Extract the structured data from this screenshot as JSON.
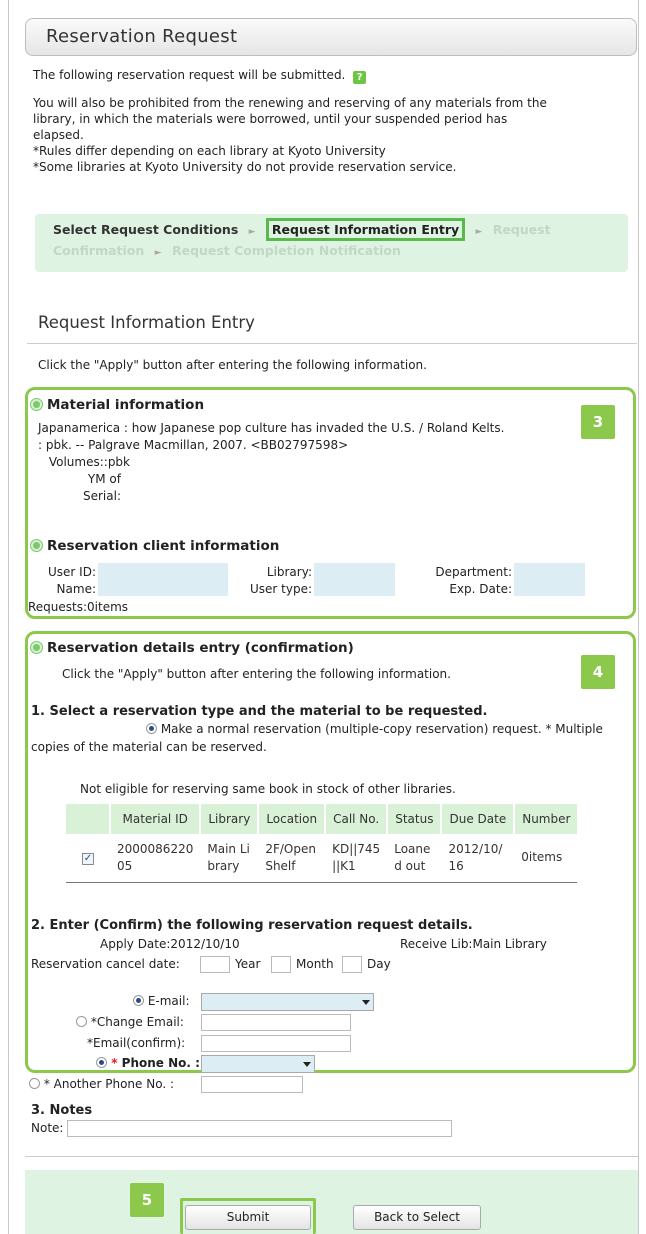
{
  "page": {
    "title": "Reservation Request",
    "intro": "The following reservation request will be submitted.",
    "help_icon": "?",
    "notice_lines": [
      "You will also be prohibited from the renewing and reserving of any materials from the",
      "library, in which the materials were borrowed, until your suspended period has",
      "elapsed.",
      "*Rules differ depending on each library at Kyoto University",
      "*Some libraries at Kyoto University do not provide reservation service."
    ]
  },
  "steps": {
    "step1": "Select Request Conditions",
    "step2": "Request Information Entry",
    "step3a": "Request",
    "step3b": "Confirmation",
    "step4": "Request Completion Notification",
    "arrow": "►"
  },
  "section": {
    "heading": "Request Information Entry",
    "instruction": "Click the \"Apply\" button after entering the following information."
  },
  "badges": {
    "b3": "3",
    "b4": "4",
    "b5": "5"
  },
  "material": {
    "heading": "Material information",
    "line1": "Japanamerica : how Japanese pop culture has invaded the U.S. / Roland Kelts.",
    "line2": ": pbk. -- Palgrave Macmillan, 2007.  <BB02797598>",
    "volumes_label": "Volumes::",
    "volumes_value": "pbk",
    "ym_label_1": "YM of",
    "ym_label_2": "Serial:"
  },
  "client": {
    "heading": "Reservation client information",
    "user_id_label": "User ID:",
    "name_label": "Name:",
    "library_label": "Library:",
    "user_type_label": "User type:",
    "department_label": "Department:",
    "exp_date_label": "Exp. Date:",
    "requests": "Requests:0items"
  },
  "details": {
    "heading": "Reservation details entry (confirmation)",
    "instruction": "Click the \"Apply\" button after entering the following information.",
    "step1_title": "1. Select a reservation type and the material to be requested.",
    "normal_option_a": "Make a normal reservation (multiple-copy reservation) request. * Multiple",
    "normal_option_b": "copies of the material can be reserved.",
    "not_eligible": "Not eligible for reserving same book in stock of other libraries.",
    "table_headers": [
      "Material ID",
      "Library",
      "Location",
      "Call No.",
      "Status",
      "Due Date",
      "Number"
    ],
    "table_row": {
      "material_id_a": "2000086220",
      "material_id_b": "05",
      "library_a": "Main Li",
      "library_b": "brary",
      "location_a": "2F/Open",
      "location_b": "Shelf",
      "call_a": "KD||745",
      "call_b": "||K1",
      "status_a": "Loane",
      "status_b": "d out",
      "due_a": "2012/10/",
      "due_b": "16",
      "number": "0items",
      "checked": "✓"
    },
    "step2_title": "2. Enter (Confirm) the following reservation request details.",
    "apply_date": "Apply Date:2012/10/10",
    "receive_lib": "Receive Lib:Main Library",
    "cancel_label": "Reservation cancel date:",
    "year": "Year",
    "month": "Month",
    "day": "Day",
    "email_label": "E-mail:",
    "change_email_label": "*Change Email:",
    "email_confirm_label": "*Email(confirm):",
    "phone_label": "Phone No. :",
    "phone_star": "*",
    "another_phone_label": "* Another Phone No. :"
  },
  "notes": {
    "title": "3. Notes",
    "label": "Note:"
  },
  "buttons": {
    "submit": "Submit",
    "back": "Back to Select"
  },
  "colors": {
    "accent_green": "#8bc84c",
    "step_band": "#dff3e2",
    "field_blue": "#dcedf3"
  }
}
